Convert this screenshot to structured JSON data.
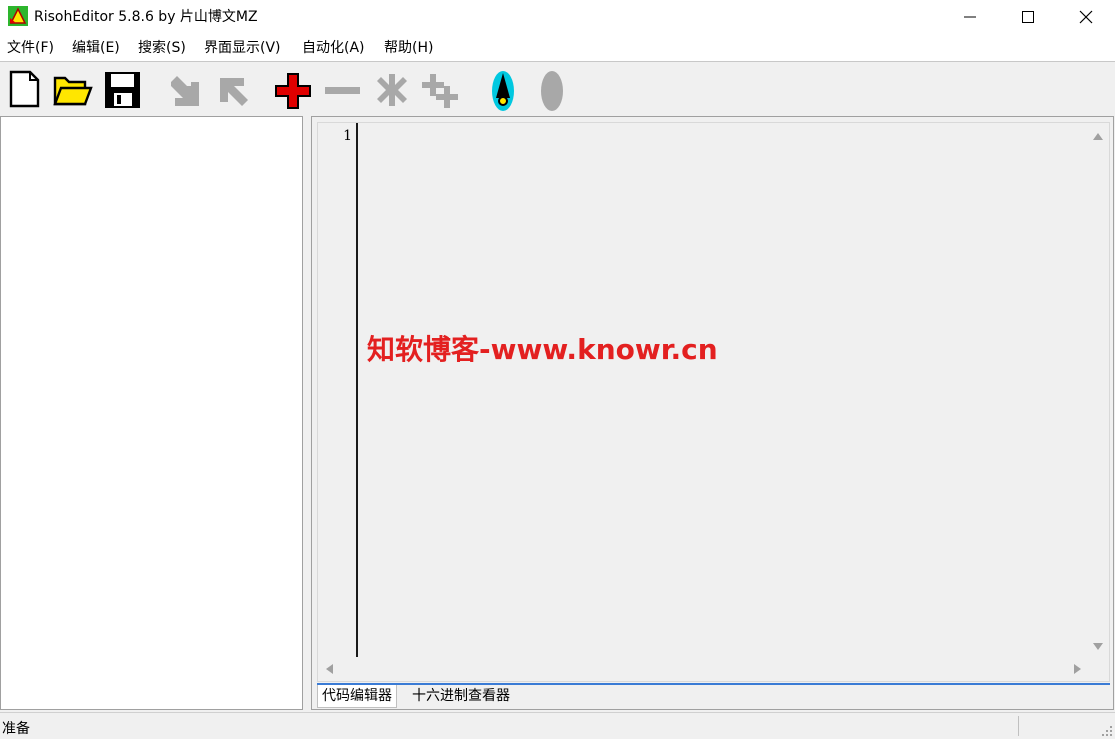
{
  "window": {
    "title": "RisohEditor 5.8.6 by 片山博文MZ",
    "controls": [
      "minimize-icon",
      "maximize-icon",
      "close-icon"
    ]
  },
  "menu": {
    "items": [
      {
        "label": "文件(F)"
      },
      {
        "label": "编辑(E)"
      },
      {
        "label": "搜索(S)"
      },
      {
        "label": "界面显示(V)"
      },
      {
        "label": "自动化(A)"
      },
      {
        "label": "帮助(H)"
      }
    ]
  },
  "toolbar": {
    "buttons": [
      {
        "icon": "new-file-icon",
        "enabled": true
      },
      {
        "icon": "open-folder-icon",
        "enabled": true
      },
      {
        "icon": "save-icon",
        "enabled": true
      },
      {
        "icon": "import-arrow-icon",
        "enabled": false
      },
      {
        "icon": "export-arrow-icon",
        "enabled": false
      },
      {
        "icon": "add-icon",
        "enabled": true
      },
      {
        "icon": "remove-icon",
        "enabled": false
      },
      {
        "icon": "modify-icon",
        "enabled": false
      },
      {
        "icon": "clone-icon",
        "enabled": false
      },
      {
        "icon": "compile-icon",
        "enabled": true
      },
      {
        "icon": "test-icon",
        "enabled": false
      }
    ],
    "colors": {
      "add": "#e00000",
      "disabled": "#a8a8a8",
      "compile": "#00c8e0",
      "folder": "#ffe600"
    }
  },
  "editor": {
    "line_numbers": [
      "1"
    ],
    "content": ""
  },
  "tabs": [
    {
      "label": "代码编辑器",
      "active": true
    },
    {
      "label": "十六进制查看器",
      "active": false
    }
  ],
  "watermark": {
    "text": "知软博客-www.knowr.cn",
    "color": "#e32020"
  },
  "status": {
    "text": "准备"
  }
}
